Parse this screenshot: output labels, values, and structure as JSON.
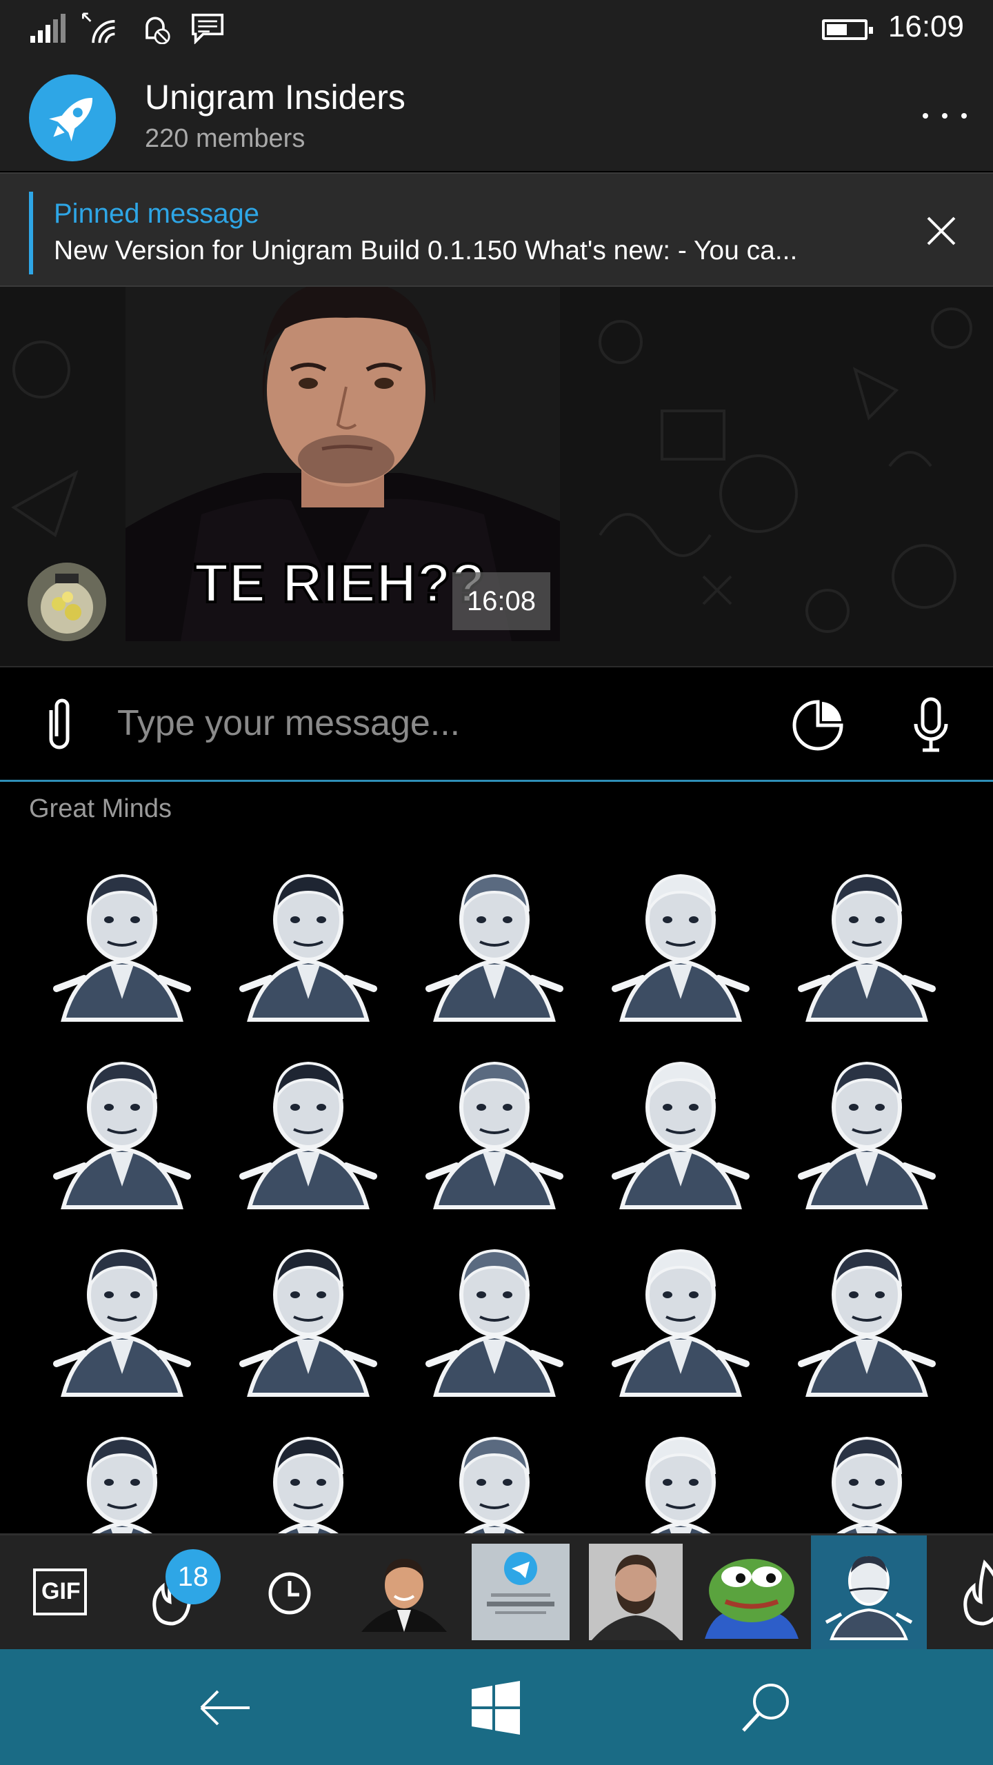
{
  "status_bar": {
    "time": "16:09",
    "icons": [
      "signal-icon",
      "wifi-icon",
      "quiet-hours-icon",
      "notification-icon",
      "battery-icon"
    ],
    "battery_level": 0.5
  },
  "header": {
    "title": "Unigram Insiders",
    "subtitle": "220 members",
    "avatar_icon": "rocket-icon",
    "more_icon": "more-icon"
  },
  "pinned": {
    "label": "Pinned message",
    "text": "New Version for Unigram Build 0.1.150 What's new: - You ca...",
    "close_icon": "close-icon"
  },
  "chat": {
    "message": {
      "caption": "TE RIEH??",
      "time": "16:08"
    }
  },
  "input": {
    "placeholder": "Type your message...",
    "attach_icon": "paperclip-icon",
    "emoji_icon": "sticker-icon",
    "mic_icon": "microphone-icon"
  },
  "sticker_panel": {
    "pack_title": "Great Minds"
  },
  "tabs": {
    "gif_label": "GIF",
    "trending_badge": "18",
    "items": [
      "gif-tab",
      "trending-tab",
      "recent-tab",
      "pack-gianni",
      "pack-telegram-gold",
      "pack-gabriel",
      "pack-pepe",
      "pack-great-minds",
      "pack-more"
    ]
  },
  "colors": {
    "accent": "#2ea6e6",
    "nav_bar": "#1a6b85",
    "active_tab": "#1e6585",
    "header_bg": "#1f1f1f"
  }
}
